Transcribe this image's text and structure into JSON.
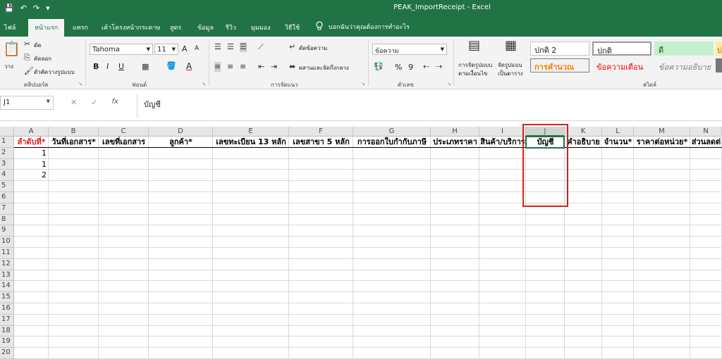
{
  "app": {
    "window_title": "PEAK_ImportReceipt  -  Excel",
    "qat": {
      "save_glyph": "💾",
      "undo_glyph": "↶",
      "redo_glyph": "↷",
      "customize_glyph": "▾"
    }
  },
  "tabs": [
    "ไฟล์",
    "หน้าแรก",
    "แทรก",
    "เค้าโครงหน้ากระดาษ",
    "สูตร",
    "ข้อมูล",
    "รีวิว",
    "มุมมอง",
    "วิธีใช้"
  ],
  "tell_me": "บอกฉันว่าคุณต้องการทำอะไร",
  "ribbon": {
    "clipboard": {
      "paste": "วาง",
      "cut": "ตัด",
      "copy": "คัดลอก",
      "format_painter": "ตัวคัดวางรูปแบบ",
      "label": "คลิปบอร์ด"
    },
    "font": {
      "name": "Tahoma",
      "size": "11",
      "bold": "B",
      "italic": "I",
      "underline": "U",
      "grow": "A",
      "shrink": "A",
      "font_color_glyph": "A",
      "label": "ฟอนต์"
    },
    "alignment": {
      "wrap": "ตัดข้อความ",
      "merge": "ผสานและจัดกึ่งกลาง",
      "label": "การจัดแนว"
    },
    "number": {
      "format": "ข้อความ",
      "percent": "%",
      "comma": "9",
      "label": "ตัวเลข"
    },
    "styles": {
      "conditional": [
        "การจัดรูปแบบ",
        "ตามเงื่อนไข"
      ],
      "format_table": [
        "จัดรูปแบบ",
        "เป็นตาราง"
      ],
      "cells": [
        "ปกติ 2",
        "ปกติ",
        "ดี",
        "ป",
        "การคำนวณ",
        "ข้อความเตือน",
        "ข้อความอธิบาย"
      ],
      "label": "สไตล์"
    }
  },
  "formula_bar": {
    "name_box": "J1",
    "cancel": "✕",
    "enter": "✓",
    "fx": "fx",
    "content": "บัญชี"
  },
  "grid": {
    "columns": [
      "A",
      "B",
      "C",
      "D",
      "E",
      "F",
      "G",
      "H",
      "I",
      "J",
      "K",
      "L",
      "M",
      "N"
    ],
    "rows": [
      "1",
      "2",
      "3",
      "4",
      "5",
      "6",
      "7",
      "8",
      "9",
      "10",
      "11",
      "12",
      "13",
      "14",
      "15",
      "16",
      "17",
      "18",
      "19",
      "20"
    ],
    "headers": [
      "ลำดับที่*",
      "วันที่เอกสาร*",
      "เลขที่เอกสาร",
      "ลูกค้า*",
      "เลขทะเบียน 13 หลัก",
      "เลขสาขา 5 หลัก",
      "การออกใบกำกับภาษี",
      "ประเภทราคา",
      "สินค้า/บริการ",
      "บัญชี",
      "คำอธิบาย",
      "จำนวน*",
      "ราคาต่อหน่วย*",
      "ส่วนลดต่"
    ],
    "a_values": [
      "1",
      "1",
      "2"
    ],
    "accent_red": "#e01b1b",
    "excel_green": "#217346"
  }
}
